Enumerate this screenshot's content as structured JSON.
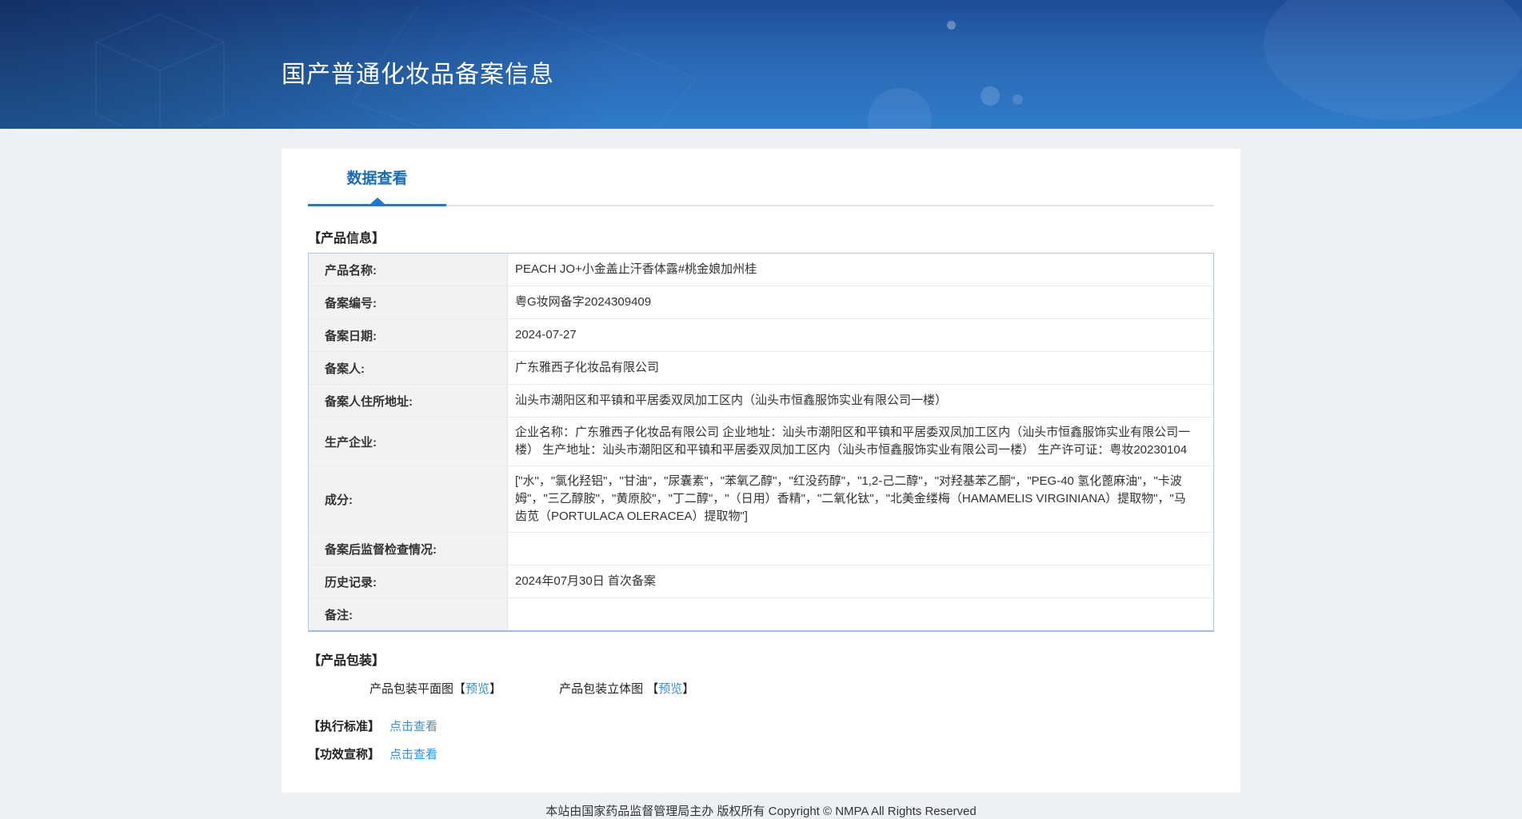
{
  "header": {
    "title": "国产普通化妆品备案信息"
  },
  "tabs": [
    {
      "label": "数据查看"
    }
  ],
  "product_info": {
    "section_title": "【产品信息】",
    "rows": [
      {
        "label": "产品名称:",
        "value": "PEACH JO+小金盖止汗香体露#桃金娘加州桂"
      },
      {
        "label": "备案编号:",
        "value": "粤G妆网备字2024309409"
      },
      {
        "label": "备案日期:",
        "value": "2024-07-27"
      },
      {
        "label": "备案人:",
        "value": "广东雅西子化妆品有限公司"
      },
      {
        "label": "备案人住所地址:",
        "value": "汕头市潮阳区和平镇和平居委双凤加工区内（汕头市恒鑫服饰实业有限公司一楼）"
      },
      {
        "label": "生产企业:",
        "value": "企业名称：广东雅西子化妆品有限公司 企业地址：汕头市潮阳区和平镇和平居委双凤加工区内（汕头市恒鑫服饰实业有限公司一楼） 生产地址：汕头市潮阳区和平镇和平居委双凤加工区内（汕头市恒鑫服饰实业有限公司一楼） 生产许可证：粤妆20230104"
      },
      {
        "label": "成分:",
        "value": "[\"水\"，\"氯化羟铝\"，\"甘油\"，\"尿囊素\"，\"苯氧乙醇\"，\"红没药醇\"，\"1,2-己二醇\"，\"对羟基苯乙酮\"，\"PEG-40 氢化蓖麻油\"，\"卡波姆\"，\"三乙醇胺\"，\"黄原胶\"，\"丁二醇\"，\"（日用）香精\"，\"二氧化钛\"，\"北美金缕梅（HAMAMELIS VIRGINIANA）提取物\"，\"马齿苋（PORTULACA OLERACEA）提取物\"]"
      },
      {
        "label": "备案后监督检查情况:",
        "value": ""
      },
      {
        "label": "历史记录:",
        "value": "2024年07月30日 首次备案"
      },
      {
        "label": "备注:",
        "value": ""
      }
    ]
  },
  "packaging": {
    "section_title": "【产品包装】",
    "items": [
      {
        "label": "产品包装平面图",
        "bracket_open": "【",
        "link": "预览",
        "bracket_close": "】"
      },
      {
        "label": "产品包装立体图 ",
        "bracket_open": "【",
        "link": "预览",
        "bracket_close": "】"
      }
    ]
  },
  "extra_links": [
    {
      "label": "【执行标准】",
      "link": "点击查看"
    },
    {
      "label": "【功效宣称】",
      "link": "点击查看"
    }
  ],
  "footer": {
    "text": "本站由国家药品监督管理局主办 版权所有 Copyright © NMPA All Rights Reserved"
  },
  "colors": {
    "header_blue": "#2f7ccb",
    "header_dark": "#1e4c97",
    "tab_blue": "#1b6cb5",
    "underline_blue": "#1e78cc",
    "link_blue": "#3a8ed8",
    "label_bg": "#f2f2f2",
    "table_border": "#abc8e6",
    "page_bg": "#eef1f4"
  }
}
